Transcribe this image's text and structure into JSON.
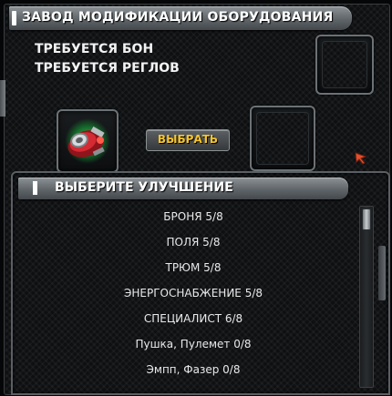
{
  "window": {
    "title": "ЗАВОД МОДИФИКАЦИИ ОБОРУДОВАНИЯ"
  },
  "requirements": [
    "ТРЕБУЕТСЯ БОН",
    "ТРЕБУЕТСЯ РЕГЛОВ"
  ],
  "select_button": {
    "label": "ВЫБРАТЬ"
  },
  "upgrade_panel": {
    "title": "ВЫБЕРИТЕ УЛУЧШЕНИЕ",
    "items": [
      {
        "label": "БРОНЯ 5/8"
      },
      {
        "label": "ПОЛЯ 5/8"
      },
      {
        "label": "ТРЮМ 5/8"
      },
      {
        "label": "ЭНЕРГОСНАБЖЕНИЕ 5/8"
      },
      {
        "label": "СПЕЦИАЛИСТ 6/8"
      },
      {
        "label": "Пушка, Пулемет 0/8"
      },
      {
        "label": "Эмпп, Фазер 0/8"
      }
    ],
    "scroll": {
      "position": 0,
      "visible_fraction": 0.12
    }
  },
  "colors": {
    "accent_button_text": "#f5c42a",
    "item_glow": "#3ddc5a",
    "item_red": "#c8202a",
    "arrow": "#e0502a"
  },
  "icons": {
    "equipped_item": "red-engine-module-icon",
    "cursor": "arrow-cursor-icon"
  }
}
